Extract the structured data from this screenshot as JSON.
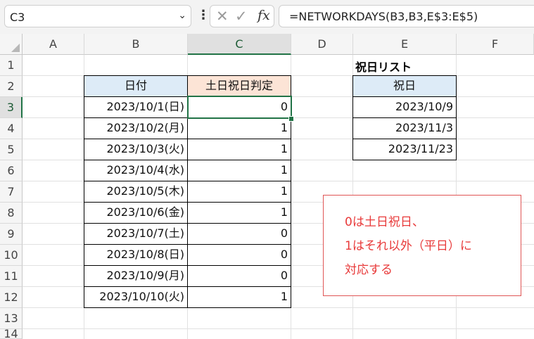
{
  "name_box": "C3",
  "formula": "=NETWORKDAYS(B3,B3,E$3:E$5)",
  "columns": [
    "A",
    "B",
    "C",
    "D",
    "E",
    "F"
  ],
  "rows": [
    "1",
    "2",
    "3",
    "4",
    "5",
    "6",
    "7",
    "8",
    "9",
    "10",
    "11",
    "12",
    "13",
    "14"
  ],
  "table": {
    "header_date": "日付",
    "header_judge": "土日祝日判定",
    "rows": [
      {
        "date": "2023/10/1(日)",
        "value": "0"
      },
      {
        "date": "2023/10/2(月)",
        "value": "1"
      },
      {
        "date": "2023/10/3(火)",
        "value": "1"
      },
      {
        "date": "2023/10/4(水)",
        "value": "1"
      },
      {
        "date": "2023/10/5(木)",
        "value": "1"
      },
      {
        "date": "2023/10/6(金)",
        "value": "1"
      },
      {
        "date": "2023/10/7(土)",
        "value": "0"
      },
      {
        "date": "2023/10/8(日)",
        "value": "0"
      },
      {
        "date": "2023/10/9(月)",
        "value": "0"
      },
      {
        "date": "2023/10/10(火)",
        "value": "1"
      }
    ]
  },
  "holidays": {
    "title": "祝日リスト",
    "header": "祝日",
    "items": [
      "2023/10/9",
      "2023/11/3",
      "2023/11/23"
    ]
  },
  "callout": {
    "lines": [
      "0は土日祝日、",
      "1はそれ以外（平日）に",
      "対応する"
    ]
  },
  "colors": {
    "accent": "#217346",
    "header_blue": "#ddebf7",
    "header_orange": "#fce4d6",
    "callout_text": "#e83a3a"
  }
}
